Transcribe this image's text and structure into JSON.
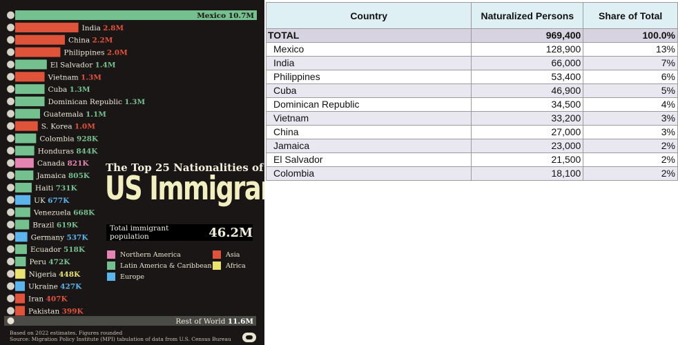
{
  "chart_data": [
    {
      "type": "bar",
      "orientation": "horizontal",
      "title": "The Top 25 Nationalities of",
      "title_main": "US Immigrants",
      "unit": "million",
      "categories": [
        "Mexico",
        "India",
        "China",
        "Philippines",
        "El Salvador",
        "Vietnam",
        "Cuba",
        "Dominican Republic",
        "Guatemala",
        "S. Korea",
        "Colombia",
        "Honduras",
        "Canada",
        "Jamaica",
        "Haiti",
        "UK",
        "Venezuela",
        "Brazil",
        "Germany",
        "Ecuador",
        "Peru",
        "Nigeria",
        "Ukraine",
        "Iran",
        "Pakistan"
      ],
      "values": [
        10.7,
        2.8,
        2.2,
        2.0,
        1.4,
        1.3,
        1.3,
        1.3,
        1.1,
        1.0,
        0.928,
        0.844,
        0.821,
        0.805,
        0.731,
        0.677,
        0.668,
        0.619,
        0.537,
        0.518,
        0.472,
        0.448,
        0.427,
        0.407,
        0.399
      ],
      "value_labels": [
        "10.7M",
        "2.8M",
        "2.2M",
        "2.0M",
        "1.4M",
        "1.3M",
        "1.3M",
        "1.3M",
        "1.1M",
        "1.0M",
        "928K",
        "844K",
        "821K",
        "805K",
        "731K",
        "677K",
        "668K",
        "619K",
        "537K",
        "518K",
        "472K",
        "448K",
        "427K",
        "407K",
        "399K"
      ],
      "regions": [
        "latin",
        "asia",
        "asia",
        "asia",
        "latin",
        "asia",
        "latin",
        "latin",
        "latin",
        "asia",
        "latin",
        "latin",
        "namerica",
        "latin",
        "latin",
        "europe",
        "latin",
        "latin",
        "europe",
        "latin",
        "latin",
        "africa",
        "europe",
        "asia",
        "asia"
      ],
      "region_colors": {
        "namerica": "#e384b3",
        "latin": "#74c08e",
        "asia": "#e0533b",
        "europe": "#5bb5ea",
        "africa": "#e8e36f"
      },
      "legend": [
        {
          "key": "namerica",
          "label": "Northern America"
        },
        {
          "key": "asia",
          "label": "Asia"
        },
        {
          "key": "latin",
          "label": "Latin America & Caribbean"
        },
        {
          "key": "africa",
          "label": "Africa"
        },
        {
          "key": "europe",
          "label": "Europe"
        }
      ],
      "legend_placement": "center-right",
      "rest_of_world": {
        "label": "Rest of World",
        "value": 11.6,
        "value_label": "11.6M"
      },
      "total_label": "Total immigrant population",
      "total_value": "46.2M",
      "footnote_lines": [
        "Based on 2022 estimates. Figures rounded",
        "Source: Migration Policy Institute (MPI) tabulation of data from U.S. Census Bureau"
      ]
    },
    {
      "type": "table",
      "columns": [
        "Country",
        "Naturalized Persons",
        "Share of Total"
      ],
      "total_row": {
        "country": "TOTAL",
        "persons": "969,400",
        "share": "100.0%"
      },
      "rows": [
        {
          "country": "Mexico",
          "persons": "128,900",
          "share": "13%"
        },
        {
          "country": "India",
          "persons": "66,000",
          "share": "7%"
        },
        {
          "country": "Philippines",
          "persons": "53,400",
          "share": "6%"
        },
        {
          "country": "Cuba",
          "persons": "46,900",
          "share": "5%"
        },
        {
          "country": "Dominican Republic",
          "persons": "34,500",
          "share": "4%"
        },
        {
          "country": "Vietnam",
          "persons": "33,200",
          "share": "3%"
        },
        {
          "country": "China",
          "persons": "27,000",
          "share": "3%"
        },
        {
          "country": "Jamaica",
          "persons": "23,000",
          "share": "2%"
        },
        {
          "country": "El Salvador",
          "persons": "21,500",
          "share": "2%"
        },
        {
          "country": "Colombia",
          "persons": "18,100",
          "share": "2%"
        }
      ]
    }
  ]
}
